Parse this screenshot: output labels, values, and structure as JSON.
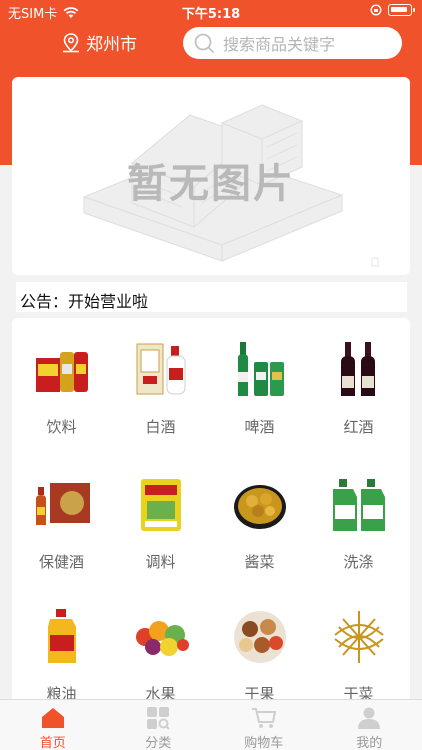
{
  "status_bar": {
    "carrier": "无SIM卡",
    "time": "下午5:18"
  },
  "header": {
    "city": "郑州市",
    "search_placeholder": "搜索商品关键字"
  },
  "banner": {
    "placeholder_text": "暂无图片"
  },
  "notice": {
    "text": "公告：开始营业啦"
  },
  "categories": [
    {
      "label": "饮料"
    },
    {
      "label": "白酒"
    },
    {
      "label": "啤酒"
    },
    {
      "label": "红酒"
    },
    {
      "label": "保健酒"
    },
    {
      "label": "调料"
    },
    {
      "label": "酱菜"
    },
    {
      "label": "洗涤"
    },
    {
      "label": "粮油"
    },
    {
      "label": "水果"
    },
    {
      "label": "干果"
    },
    {
      "label": "干菜"
    }
  ],
  "tabbar": {
    "items": [
      {
        "label": "首页"
      },
      {
        "label": "分类"
      },
      {
        "label": "购物车"
      },
      {
        "label": "我的"
      }
    ]
  },
  "colors": {
    "brand": "#f0522b",
    "page_bg": "#f2f2f2",
    "muted_text": "#999999"
  }
}
